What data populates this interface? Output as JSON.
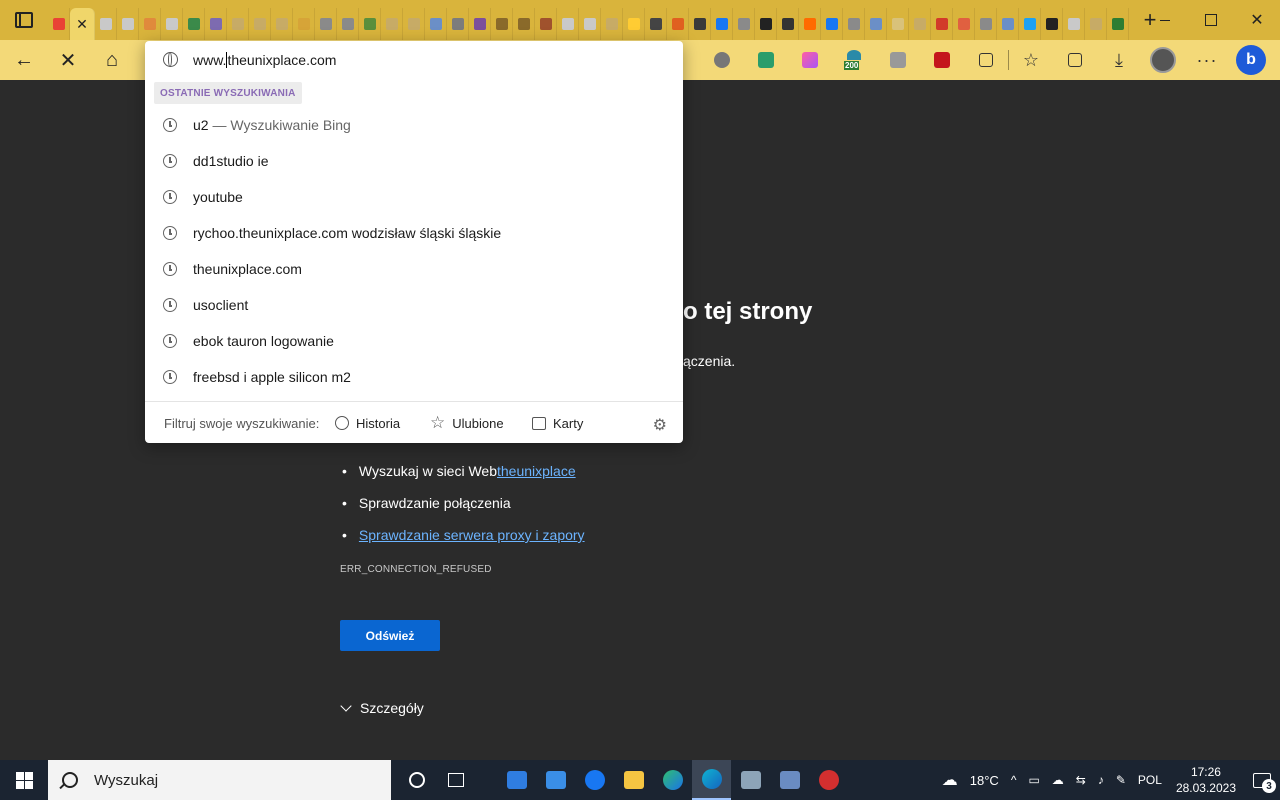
{
  "tabs": {
    "favicons": [
      "#e94235",
      "#c9c9c9",
      "#c9c9c9",
      "#e08a3c",
      "#c9c9c9",
      "#3b8a4a",
      "#7d6bb0",
      "#c7ab66",
      "#c7ab66",
      "#c7ab66",
      "#d6a438",
      "#8a8a8a",
      "#8a8a8a",
      "#5a8f3c",
      "#c7ab66",
      "#c7ab66",
      "#6b8fc7",
      "#7c7c7c",
      "#7c4f9c",
      "#8a6a2a",
      "#8a6a2a",
      "#a0522d",
      "#c9c9c9",
      "#c9c9c9",
      "#c7ab66",
      "#ffcc33",
      "#444",
      "#e06020",
      "#3a3a3a",
      "#1877f2",
      "#8a8a8a",
      "#222",
      "#333",
      "#ff6a00",
      "#1877f2",
      "#8a8a8a",
      "#6b8fc7",
      "#d9c27a",
      "#c7ab66",
      "#d23a2a",
      "#e06040",
      "#8a8a8a",
      "#6b8fc7",
      "#1da1f2",
      "#222",
      "#c9c9c9",
      "#c7ab66",
      "#2e7d32"
    ],
    "active_close": "✕",
    "new_tab": "+"
  },
  "window": {
    "minimize": "—",
    "close": "✕"
  },
  "toolbar": {
    "back": "←",
    "stop": "✕",
    "home": "⌂",
    "ext_badge": "200"
  },
  "omnibox": {
    "typed": "www.",
    "completion": "theunixplace.com",
    "section_label": "OSTATNIE WYSZUKIWANIA",
    "history": [
      {
        "text": "u2",
        "suffix": " — Wyszukiwanie Bing"
      },
      {
        "text": "dd1studio ie",
        "suffix": ""
      },
      {
        "text": "youtube",
        "suffix": ""
      },
      {
        "text": "rychoo.theunixplace.com wodzisław śląski śląskie",
        "suffix": ""
      },
      {
        "text": "theunixplace.com",
        "suffix": ""
      },
      {
        "text": "usoclient",
        "suffix": ""
      },
      {
        "text": "ebok tauron logowanie",
        "suffix": ""
      },
      {
        "text": "freebsd i apple silicon m2",
        "suffix": ""
      }
    ],
    "filter_label": "Filtruj swoje wyszukiwanie:",
    "filters": [
      "Historia",
      "Ulubione",
      "Karty"
    ]
  },
  "page": {
    "heading_partial": "o tej strony",
    "subtext_partial": "ączenia.",
    "suggestions": [
      {
        "prefix": "Wyszukaj w sieci Web ",
        "link": "theunixplace"
      },
      {
        "prefix": "Sprawdzanie połączenia",
        "link": ""
      },
      {
        "prefix": "",
        "link": "Sprawdzanie serwera proxy i zapory"
      }
    ],
    "error_code": "ERR_CONNECTION_REFUSED",
    "refresh_button": "Odśwież",
    "details": "Szczegóły"
  },
  "taskbar": {
    "search_placeholder": "Wyszukaj",
    "weather": "18°C",
    "language": "POL",
    "time": "17:26",
    "date": "28.03.2023",
    "notifications": "3"
  }
}
